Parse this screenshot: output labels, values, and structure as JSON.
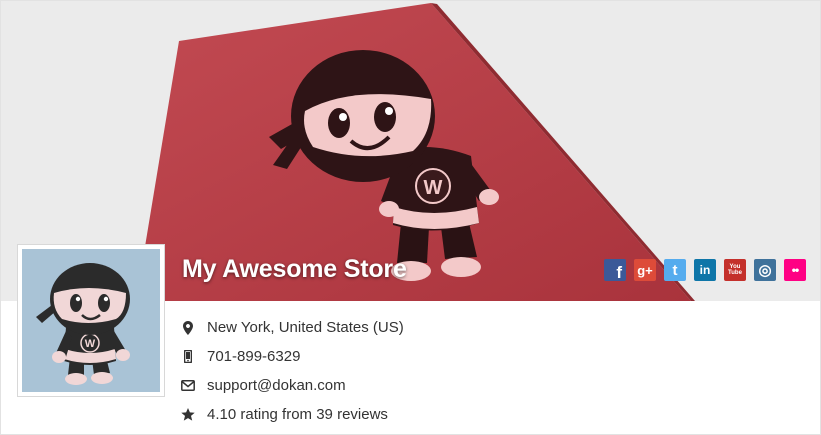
{
  "store": {
    "name": "My Awesome Store",
    "address": "New York, United States (US)",
    "phone": "701-899-6329",
    "email": "support@dokan.com",
    "rating": "4.10 rating from 39 reviews"
  },
  "banner": {
    "background": "#ebebeb",
    "poster_color": "#b23c45",
    "poster_letter": "W"
  },
  "avatar": {
    "background": "#a9c3d6",
    "letter": "W"
  },
  "social": [
    {
      "name": "facebook",
      "glyph": "f",
      "color": "#3b5998"
    },
    {
      "name": "google-plus",
      "glyph": "g+",
      "color": "#dd4b39"
    },
    {
      "name": "twitter",
      "glyph": "t",
      "color": "#55acee"
    },
    {
      "name": "linkedin",
      "glyph": "in",
      "color": "#0e76a8"
    },
    {
      "name": "youtube",
      "glyph": "You Tube",
      "color": "#c4302b"
    },
    {
      "name": "instagram",
      "glyph": "◎",
      "color": "#3f729b"
    },
    {
      "name": "flickr",
      "glyph": "••",
      "color": "#ff0084"
    }
  ],
  "icons": {
    "address": "map-marker-icon",
    "phone": "mobile-phone-icon",
    "email": "envelope-icon",
    "rating": "star-icon"
  }
}
